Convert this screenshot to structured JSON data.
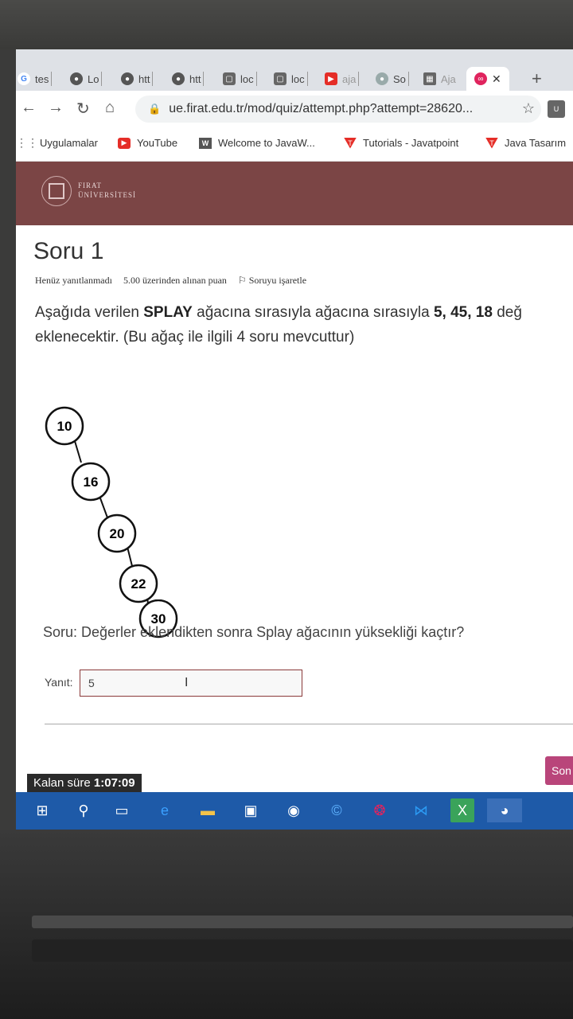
{
  "browser": {
    "tabs": [
      {
        "icon": "google-icon",
        "label": "tes"
      },
      {
        "icon": "globe-icon",
        "label": "Lo"
      },
      {
        "icon": "globe-icon",
        "label": "htt"
      },
      {
        "icon": "globe-icon",
        "label": "htt"
      },
      {
        "icon": "chat-icon",
        "label": "loc"
      },
      {
        "icon": "chat-icon",
        "label": "loc"
      },
      {
        "icon": "youtube-icon",
        "label": "aja"
      },
      {
        "icon": "globe-icon",
        "label": "So"
      },
      {
        "icon": "grid-icon",
        "label": "Aja"
      }
    ],
    "active_tab_icon": "infinity-icon",
    "close_glyph": "✕",
    "new_tab_glyph": "+",
    "url": "ue.firat.edu.tr/mod/quiz/attempt.php?attempt=28620...",
    "bookmarks": [
      {
        "icon": "apps-icon",
        "label": "Uygulamalar"
      },
      {
        "icon": "youtube-icon",
        "label": "YouTube"
      },
      {
        "icon": "w-icon",
        "label": "Welcome to JavaW..."
      },
      {
        "icon": "javatpoint-icon",
        "label": "Tutorials - Javatpoint"
      },
      {
        "icon": "javatpoint-icon",
        "label": "Java Tasarım"
      }
    ]
  },
  "site": {
    "logo_line1": "FIRAT",
    "logo_line2": "ÜNİVERSİTESİ",
    "header_color": "#7b4545"
  },
  "question": {
    "title": "Soru 1",
    "status": "Henüz yanıtlanmadı",
    "points": "5.00 üzerinden alınan puan",
    "flag_label": "Soruyu işaretle",
    "text_pre": "Aşağıda verilen ",
    "text_bold1": "SPLAY",
    "text_mid": " ağacına sırasıyla ağacına sırasıyla ",
    "text_bold2": "5, 45, 18",
    "text_end": " değ",
    "text_line2": "eklenecektir. (Bu ağaç ile ilgili 4 soru mevcuttur)",
    "tree_nodes": [
      "10",
      "16",
      "20",
      "22",
      "30"
    ],
    "subquestion": "Soru: Değerler eklendikten sonra Splay ağacının yüksekliği kaçtır?",
    "answer_label": "Yanıt:",
    "answer_value": "5",
    "next_button": "Son",
    "timer_label": "Kalan süre",
    "timer_value": "1:07:09"
  }
}
